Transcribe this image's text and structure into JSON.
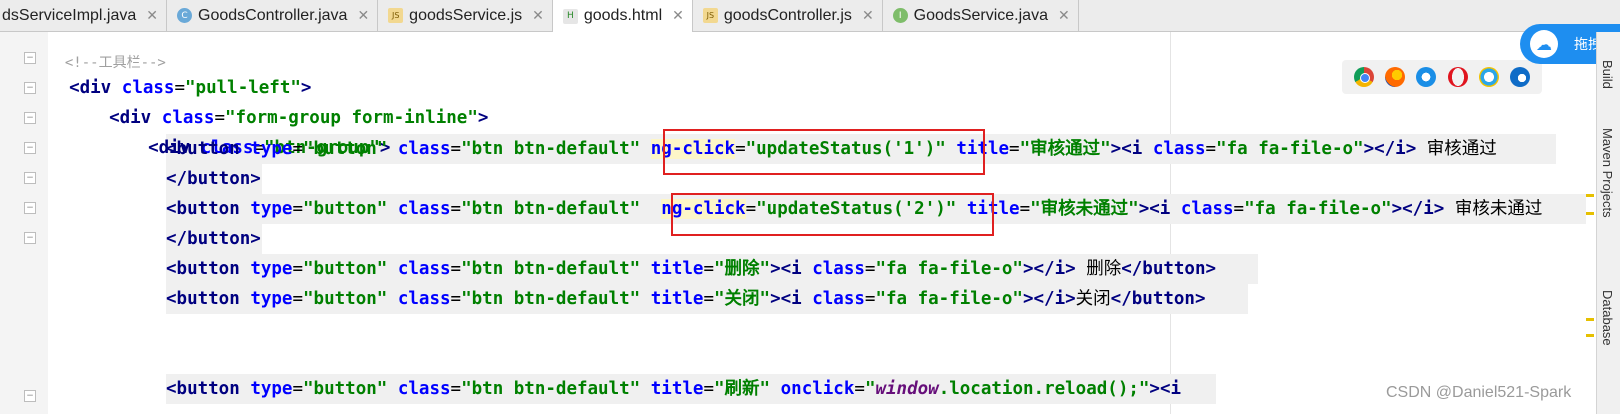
{
  "tabs": [
    {
      "label": "dsServiceImpl.java",
      "icon": "class-icon",
      "kind": "c"
    },
    {
      "label": "GoodsController.java",
      "icon": "class-icon",
      "kind": "c"
    },
    {
      "label": "goodsService.js",
      "icon": "js-file-icon",
      "kind": "js"
    },
    {
      "label": "goods.html",
      "icon": "html-file-icon",
      "kind": "h",
      "active": true
    },
    {
      "label": "goodsController.js",
      "icon": "js-file-icon",
      "kind": "js"
    },
    {
      "label": "GoodsService.java",
      "icon": "interface-icon",
      "kind": "i"
    }
  ],
  "code": {
    "line0_partial": "<!--工具栏-->",
    "line1": {
      "tag_open": "<div",
      "attr": "class",
      "value": "\"pull-left\"",
      "close": ">"
    },
    "line2": {
      "tag_open": "<div",
      "attr": "class",
      "value": "\"form-group form-inline\"",
      "close": ">"
    },
    "line3": {
      "tag_open": "<div",
      "attr": "class",
      "value": "\"btn-group\"",
      "close": ">"
    },
    "line4": {
      "tag_open": "<button",
      "a1": "type",
      "v1": "\"button\"",
      "a2": "class",
      "v2": "\"btn btn-default\"",
      "a3": "ng-click",
      "v3": "\"updateStatus('1')\"",
      "a4": "title",
      "v4": "\"审核通过\"",
      "i_open": "><i",
      "a5": "class",
      "v5": "\"fa fa-file-o\"",
      "i_close": "></i>",
      "text": " 审核通过"
    },
    "line5": "</button>",
    "line6": {
      "tag_open": "<button",
      "a1": "type",
      "v1": "\"button\"",
      "a2": "class",
      "v2": "\"btn btn-default\"",
      "a3": "ng-click",
      "v3": "\"updateStatus('2')\"",
      "a4": "title",
      "v4": "\"审核未通过\"",
      "i_open": "><i",
      "a5": "class",
      "v5": "\"fa fa-file-o\"",
      "i_close": "></i>",
      "text": " 审核未通过"
    },
    "line7": "</button>",
    "line8": {
      "tag_open": "<button",
      "a1": "type",
      "v1": "\"button\"",
      "a2": "class",
      "v2": "\"btn btn-default\"",
      "a4": "title",
      "v4": "\"删除\"",
      "i_open": "><i",
      "a5": "class",
      "v5": "\"fa fa-file-o\"",
      "i_close": "></i>",
      "text": " 删除",
      "end": "</button>"
    },
    "line9": {
      "tag_open": "<button",
      "a1": "type",
      "v1": "\"button\"",
      "a2": "class",
      "v2": "\"btn btn-default\"",
      "a4": "title",
      "v4": "\"关闭\"",
      "i_open": "><i",
      "a5": "class",
      "v5": "\"fa fa-file-o\"",
      "i_close": "></i>",
      "text": "关闭",
      "end": "</button>"
    },
    "line12": {
      "tag_open": "<button",
      "a1": "type",
      "v1": "\"button\"",
      "a2": "class",
      "v2": "\"btn btn-default\"",
      "a4": "title",
      "v4": "\"刷新\"",
      "a6": "onclick",
      "v6a": "\"",
      "v6b": "window",
      "v6c": ".location.",
      "v6d": "reload();\"",
      "tail": "><i"
    }
  },
  "browsers": [
    "chrome-icon",
    "firefox-icon",
    "safari-icon",
    "opera-icon",
    "ie-icon",
    "edge-icon"
  ],
  "cloud_label": "拖拽",
  "sidebar": {
    "top": "Build",
    "middle": "Maven Projects",
    "bottom": "Database"
  },
  "watermark": "CSDN @Daniel521-Spark",
  "colors": {
    "tag": "#000080",
    "attr": "#0000ff",
    "value": "#008000",
    "highlight_box": "#e02020"
  }
}
